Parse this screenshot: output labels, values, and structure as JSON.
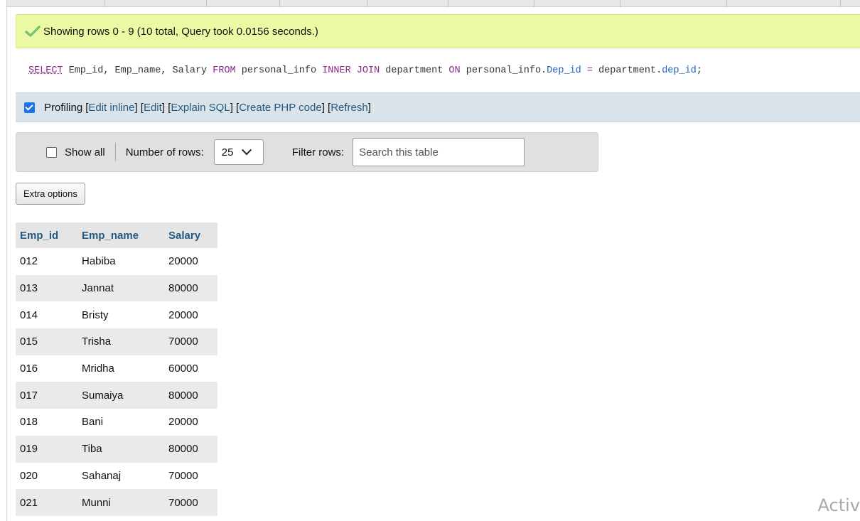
{
  "message": {
    "text": "Showing rows 0 - 9 (10 total, Query took 0.0156 seconds.)",
    "icon": "success-check-icon",
    "color": "#ebf8a4"
  },
  "sql": {
    "select": "SELECT",
    "cols": " Emp_id, Emp_name, Salary ",
    "from": "FROM",
    "table1": " personal_info ",
    "inner": "INNER JOIN",
    "table2": " department ",
    "on": "ON",
    "left_tbl": " personal_info.",
    "left_col": "Dep_id",
    "eq": " = ",
    "right_tbl": "department.",
    "right_col": "dep_id",
    "end": ";"
  },
  "profiling": {
    "checked": true,
    "label": "Profiling",
    "links": [
      "Edit inline",
      "Edit",
      "Explain SQL",
      "Create PHP code",
      "Refresh"
    ]
  },
  "nav": {
    "show_all": "Show all",
    "rows_label": "Number of rows:",
    "rows_value": "25",
    "filter_label": "Filter rows:",
    "search_placeholder": "Search this table"
  },
  "extra_options": "Extra options",
  "table": {
    "headers": [
      "Emp_id",
      "Emp_name",
      "Salary"
    ],
    "rows": [
      [
        "012",
        "Habiba",
        "20000"
      ],
      [
        "013",
        "Jannat",
        "80000"
      ],
      [
        "014",
        "Bristy",
        "20000"
      ],
      [
        "015",
        "Trisha",
        "70000"
      ],
      [
        "016",
        "Mridha",
        "60000"
      ],
      [
        "017",
        "Sumaiya",
        "80000"
      ],
      [
        "018",
        "Bani",
        "20000"
      ],
      [
        "019",
        "Tiba",
        "80000"
      ],
      [
        "020",
        "Sahanaj",
        "70000"
      ],
      [
        "021",
        "Munni",
        "70000"
      ]
    ]
  },
  "watermark": "Activ"
}
